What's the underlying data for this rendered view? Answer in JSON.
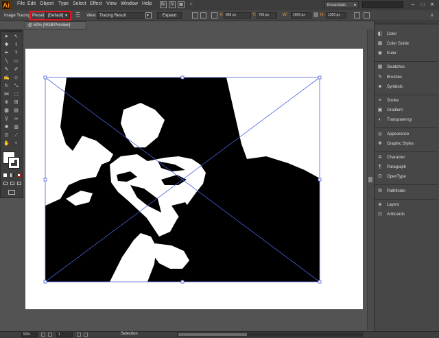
{
  "menubar": {
    "logo": "Ai",
    "items": [
      "File",
      "Edit",
      "Object",
      "Type",
      "Select",
      "Effect",
      "View",
      "Window",
      "Help"
    ],
    "workspace": "Essentials",
    "window_controls": [
      "–",
      "□",
      "✕"
    ]
  },
  "controlbar": {
    "panel_label": "Image Tracing",
    "preset_label": "Preset:",
    "preset_value": "[Default]",
    "view_label": "View:",
    "view_value": "Tracing Result",
    "expand_label": "Expand",
    "x_label": "X:",
    "x_value": "965 px",
    "y_label": "Y:",
    "y_value": "750 px",
    "w_label": "W:",
    "w_value": "1600 px",
    "h_label": "H:",
    "h_value": "1200 px"
  },
  "document": {
    "tab_label": "@ 50% (RGB/Preview)"
  },
  "statusbar": {
    "zoom": "50%",
    "page": "1",
    "tool_status": "Selection"
  },
  "panels": {
    "group1": [
      {
        "label": "Color",
        "icon": "color-icon"
      },
      {
        "label": "Color Guide",
        "icon": "color-guide-icon"
      },
      {
        "label": "Kuler",
        "icon": "kuler-icon"
      }
    ],
    "group2": [
      {
        "label": "Swatches",
        "icon": "swatches-icon"
      },
      {
        "label": "Brushes",
        "icon": "brushes-icon"
      },
      {
        "label": "Symbols",
        "icon": "symbols-icon"
      }
    ],
    "group3": [
      {
        "label": "Stroke",
        "icon": "stroke-icon"
      },
      {
        "label": "Gradient",
        "icon": "gradient-icon"
      },
      {
        "label": "Transparency",
        "icon": "transparency-icon"
      }
    ],
    "group4": [
      {
        "label": "Appearance",
        "icon": "appearance-icon"
      },
      {
        "label": "Graphic Styles",
        "icon": "graphic-styles-icon"
      }
    ],
    "group5": [
      {
        "label": "Character",
        "icon": "character-icon"
      },
      {
        "label": "Paragraph",
        "icon": "paragraph-icon"
      },
      {
        "label": "OpenType",
        "icon": "opentype-icon"
      }
    ],
    "group6": [
      {
        "label": "Pathfinder",
        "icon": "pathfinder-icon"
      }
    ],
    "group7": [
      {
        "label": "Layers",
        "icon": "layers-icon"
      },
      {
        "label": "Artboards",
        "icon": "artboards-icon"
      }
    ]
  },
  "colors": {
    "highlight": "#e01b24",
    "selection": "#4b5fd6",
    "accent": "#f7931e"
  }
}
